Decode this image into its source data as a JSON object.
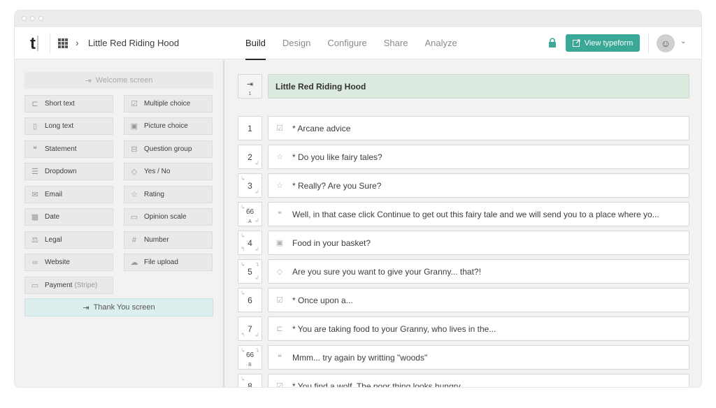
{
  "header": {
    "logo": "t",
    "breadcrumb_title": "Little Red Riding Hood",
    "tabs": [
      {
        "label": "Build",
        "active": true
      },
      {
        "label": "Design",
        "active": false
      },
      {
        "label": "Configure",
        "active": false
      },
      {
        "label": "Share",
        "active": false
      },
      {
        "label": "Analyze",
        "active": false
      }
    ],
    "view_button": "View typeform",
    "accent_color": "#3aa896"
  },
  "sidebar": {
    "welcome": "Welcome screen",
    "question_types": [
      {
        "label": "Short text",
        "icon": "short-text-icon"
      },
      {
        "label": "Multiple choice",
        "icon": "multiple-choice-icon"
      },
      {
        "label": "Long text",
        "icon": "long-text-icon"
      },
      {
        "label": "Picture choice",
        "icon": "picture-choice-icon"
      },
      {
        "label": "Statement",
        "icon": "statement-icon"
      },
      {
        "label": "Question group",
        "icon": "question-group-icon"
      },
      {
        "label": "Dropdown",
        "icon": "dropdown-icon"
      },
      {
        "label": "Yes / No",
        "icon": "yes-no-icon"
      },
      {
        "label": "Email",
        "icon": "email-icon"
      },
      {
        "label": "Rating",
        "icon": "rating-icon"
      },
      {
        "label": "Date",
        "icon": "date-icon"
      },
      {
        "label": "Opinion scale",
        "icon": "opinion-scale-icon"
      },
      {
        "label": "Legal",
        "icon": "legal-icon"
      },
      {
        "label": "Number",
        "icon": "number-icon"
      },
      {
        "label": "Website",
        "icon": "website-icon"
      },
      {
        "label": "File upload",
        "icon": "file-upload-icon"
      }
    ],
    "payment": {
      "label": "Payment",
      "suffix": "(Stripe)"
    },
    "thank_you": "Thank You screen"
  },
  "main": {
    "welcome_card": {
      "number": "1",
      "title": "Little Red Riding Hood"
    },
    "questions": [
      {
        "number": "1",
        "sub": "",
        "icon": "multiple-choice-icon",
        "text": "* Arcane advice"
      },
      {
        "number": "2",
        "sub": "",
        "icon": "rating-icon",
        "text": "* Do you like fairy tales?"
      },
      {
        "number": "3",
        "sub": "",
        "icon": "rating-icon",
        "text": "* Really? Are you Sure?"
      },
      {
        "number": "66",
        "sub": "A",
        "icon": "statement-icon",
        "text": "Well, in that case click Continue to get out this fairy tale and we will send you to a place where yo..."
      },
      {
        "number": "4",
        "sub": "",
        "icon": "picture-choice-icon",
        "text": "Food in your basket?"
      },
      {
        "number": "5",
        "sub": "",
        "icon": "yes-no-icon",
        "text": "Are you sure you want to give your Granny... that?!"
      },
      {
        "number": "6",
        "sub": "",
        "icon": "multiple-choice-icon",
        "text": "* Once upon a..."
      },
      {
        "number": "7",
        "sub": "",
        "icon": "short-text-icon",
        "text": "* You are taking food to your Granny, who lives in the..."
      },
      {
        "number": "66",
        "sub": "B",
        "icon": "statement-icon",
        "text": "Mmm... try again by writting \"woods\""
      },
      {
        "number": "8",
        "sub": "",
        "icon": "multiple-choice-icon",
        "text": "* You find a wolf. The poor thing looks hungry."
      }
    ]
  }
}
